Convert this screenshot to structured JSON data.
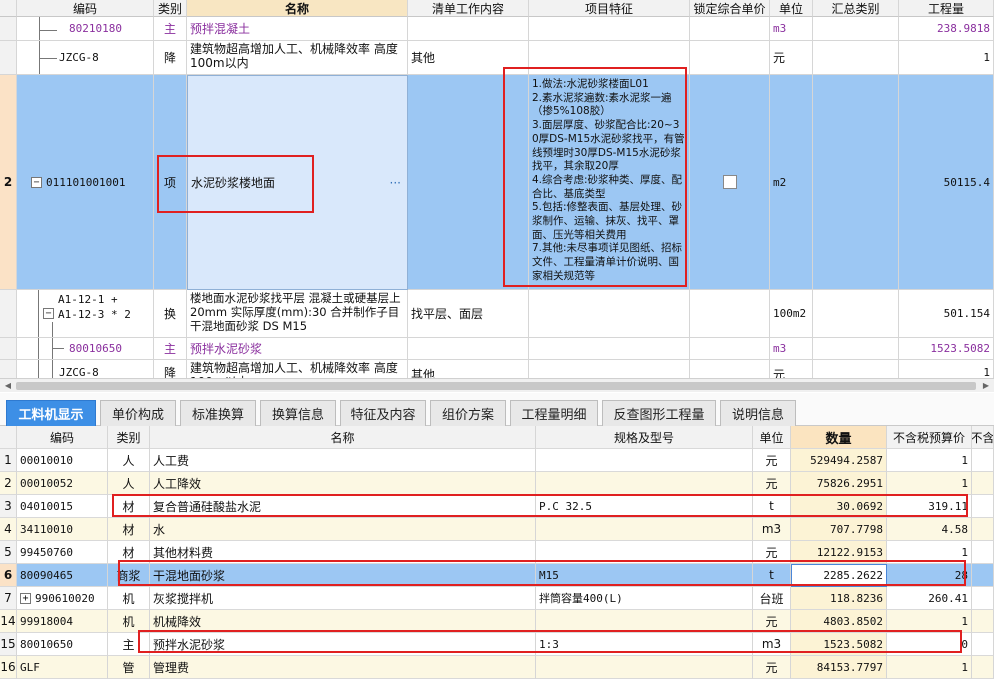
{
  "top_headers": [
    "编码",
    "类别",
    "名称",
    "清单工作内容",
    "项目特征",
    "锁定综合单价",
    "单位",
    "汇总类别",
    "工程量"
  ],
  "top_rows": {
    "r1": {
      "code": "80210180",
      "type": "主",
      "name": "预拌混凝土",
      "unit": "m3",
      "qty": "238.9818"
    },
    "r2": {
      "code": "JZCG-8",
      "type": "降",
      "name": "建筑物超高增加人工、机械降效率 高度100m以内",
      "work": "其他",
      "unit": "元",
      "qty": "1"
    },
    "r3": {
      "num": "2",
      "code": "011101001001",
      "type": "项",
      "name": "水泥砂浆楼地面",
      "ellipsis": "···",
      "feature": "1.做法:水泥砂浆楼面L01\n2.素水泥浆遍数:素水泥浆一遍（掺5%108胶）\n3.面层厚度、砂浆配合比:20~30厚DS-M15水泥砂浆找平，有管线预埋时30厚DS-M15水泥砂浆找平，其余取20厚\n4.综合考虑:砂浆种类、厚度、配合比、基底类型\n5.包括:修整表面、基层处理、砂浆制作、运输、抹灰、找平、罩面、压光等相关费用\n7.其他:未尽事项详见图纸、招标文件、工程量清单计价说明、国家相关规范等",
      "unit": "m2",
      "qty": "50115.4"
    },
    "r4": {
      "code_line1": "A1-12-1 +",
      "code_line2": "A1-12-3 * 2",
      "type": "换",
      "name": "楼地面水泥砂浆找平层 混凝土或硬基层上 20mm 实际厚度(mm):30 合并制作子目 干混地面砂浆 DS M15",
      "work": "找平层、面层",
      "unit": "100m2",
      "qty": "501.154"
    },
    "r5": {
      "code": "80010650",
      "type": "主",
      "name": "预拌水泥砂浆",
      "unit": "m3",
      "qty": "1523.5082"
    },
    "r6": {
      "code": "JZCG-8",
      "type": "降",
      "name": "建筑物超高增加人工、机械降效率 高度100m以内",
      "work": "其他",
      "unit": "元",
      "qty": "1"
    }
  },
  "tabs": [
    "工料机显示",
    "单价构成",
    "标准换算",
    "换算信息",
    "特征及内容",
    "组价方案",
    "工程量明细",
    "反查图形工程量",
    "说明信息"
  ],
  "bottom_headers": [
    "编码",
    "类别",
    "名称",
    "规格及型号",
    "单位",
    "数量",
    "不含税预算价",
    "不含"
  ],
  "bottom_rows": [
    {
      "num": "1",
      "code": "00010010",
      "type": "人",
      "name": "人工费",
      "spec": "",
      "unit": "元",
      "qty": "529494.2587",
      "price": "1"
    },
    {
      "num": "2",
      "code": "00010052",
      "type": "人",
      "name": "人工降效",
      "spec": "",
      "unit": "元",
      "qty": "75826.2951",
      "price": "1"
    },
    {
      "num": "3",
      "code": "04010015",
      "type": "材",
      "name": "复合普通硅酸盐水泥",
      "spec": "P.C 32.5",
      "unit": "t",
      "qty": "30.0692",
      "price": "319.11"
    },
    {
      "num": "4",
      "code": "34110010",
      "type": "材",
      "name": "水",
      "spec": "",
      "unit": "m3",
      "qty": "707.7798",
      "price": "4.58"
    },
    {
      "num": "5",
      "code": "99450760",
      "type": "材",
      "name": "其他材料费",
      "spec": "",
      "unit": "元",
      "qty": "12122.9153",
      "price": "1"
    },
    {
      "num": "6",
      "code": "80090465",
      "type": "商浆",
      "name": "干混地面砂浆",
      "spec": "M15",
      "unit": "t",
      "qty": "2285.2622",
      "price": "28"
    },
    {
      "num": "7",
      "code": "990610020",
      "type": "机",
      "name": "灰浆搅拌机",
      "spec": "拌筒容量400(L)",
      "unit": "台班",
      "qty": "118.8236",
      "price": "260.41"
    },
    {
      "num": "14",
      "code": "99918004",
      "type": "机",
      "name": "机械降效",
      "spec": "",
      "unit": "元",
      "qty": "4803.8502",
      "price": "1"
    },
    {
      "num": "15",
      "code": "80010650",
      "type": "主",
      "name": "预拌水泥砂浆",
      "spec": "1:3",
      "unit": "m3",
      "qty": "1523.5082",
      "price": "0"
    },
    {
      "num": "16",
      "code": "GLF",
      "type": "管",
      "name": "管理费",
      "spec": "",
      "unit": "元",
      "qty": "84153.7797",
      "price": "1"
    }
  ]
}
